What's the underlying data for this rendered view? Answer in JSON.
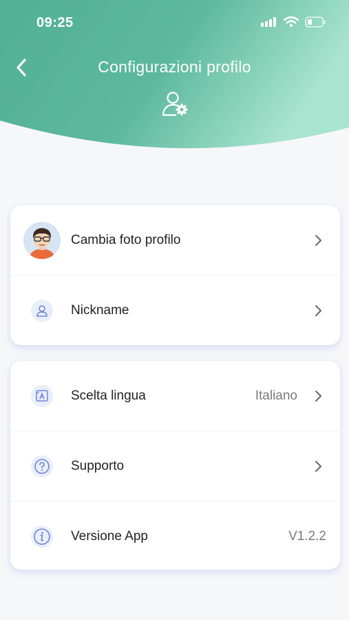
{
  "status_bar": {
    "time": "09:25"
  },
  "header": {
    "title": "Configurazioni profilo"
  },
  "colors": {
    "header_left": "#57b598",
    "header_right": "#a7e3cf",
    "accent": "#6e83d6"
  },
  "profile_section": [
    {
      "label": "Cambia foto profilo",
      "icon": "avatar-image"
    },
    {
      "label": "Nickname",
      "icon": "user-icon"
    }
  ],
  "settings_section": [
    {
      "label": "Scelta lingua",
      "value": "Italiano",
      "icon": "translate-icon"
    },
    {
      "label": "Supporto",
      "icon": "question-icon"
    },
    {
      "label": "Versione App",
      "value": "V1.2.2",
      "icon": "info-icon"
    }
  ]
}
